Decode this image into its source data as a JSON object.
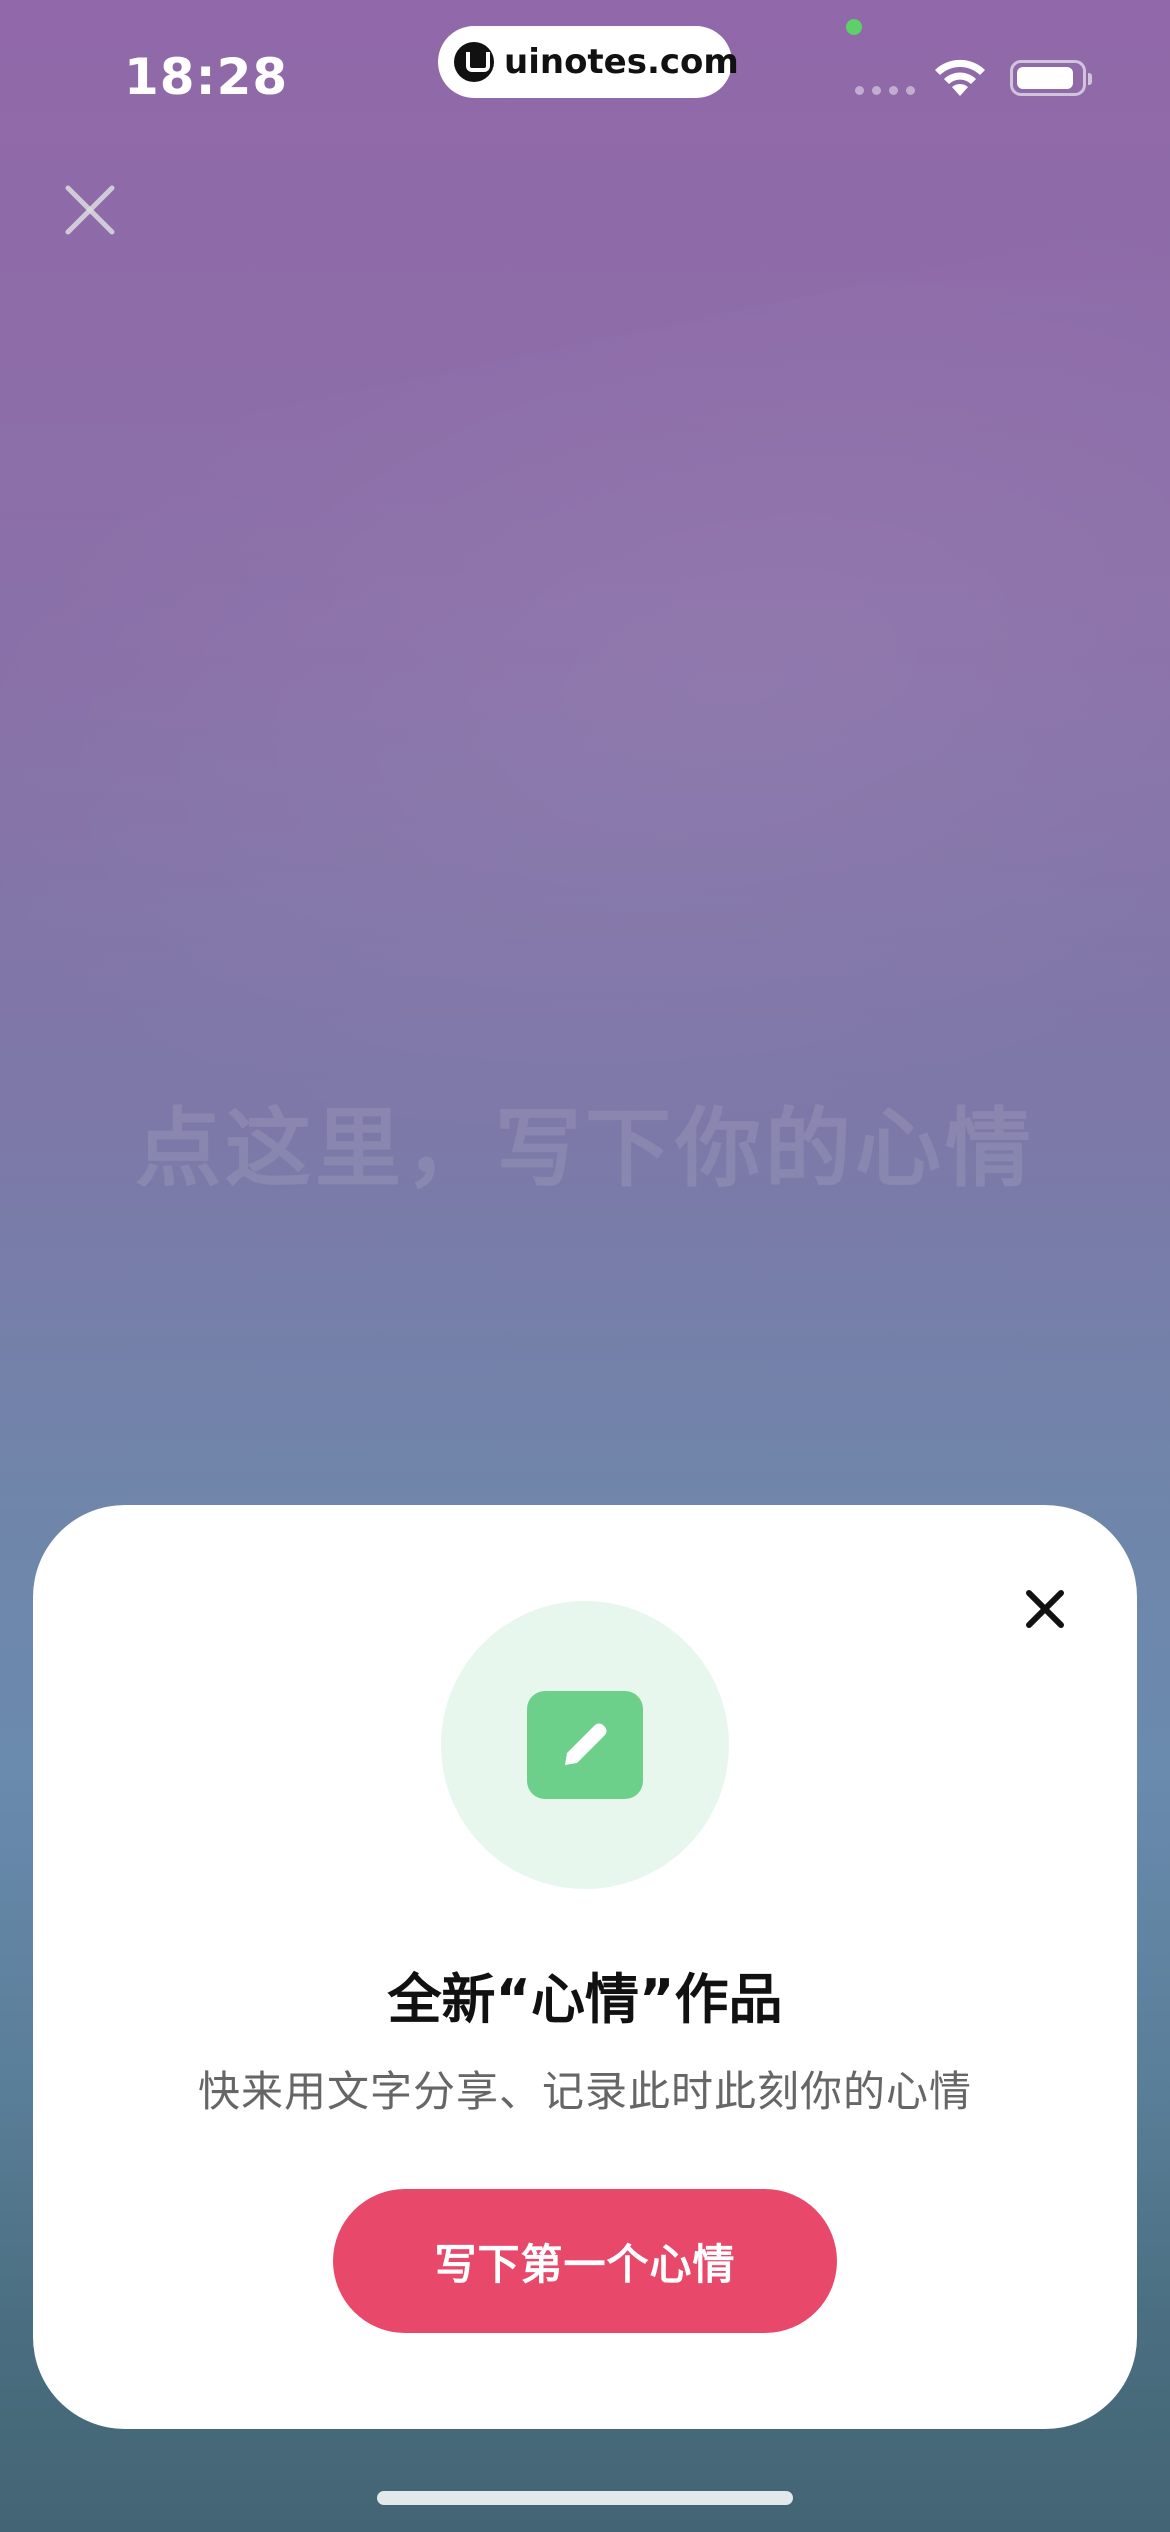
{
  "status_bar": {
    "time": "18:28",
    "url": "uinotes.com"
  },
  "editor": {
    "placeholder": "点这里，写下你的心情"
  },
  "sheet": {
    "title": "全新“心情”作品",
    "subtitle": "快来用文字分享、记录此时此刻你的心情",
    "cta_label": "写下第一个心情"
  },
  "icons": {
    "top_close": "close-icon",
    "sheet_close": "close-icon",
    "feature": "pencil-icon",
    "wifi": "wifi-icon",
    "battery": "battery-icon",
    "site_logo": "uinotes-logo-icon"
  },
  "colors": {
    "accent": "#e8496a",
    "feature_green": "#6ccf8a",
    "feature_circle": "#e8f7ee",
    "background_top": "#9168a9",
    "background_bottom": "#436474"
  }
}
